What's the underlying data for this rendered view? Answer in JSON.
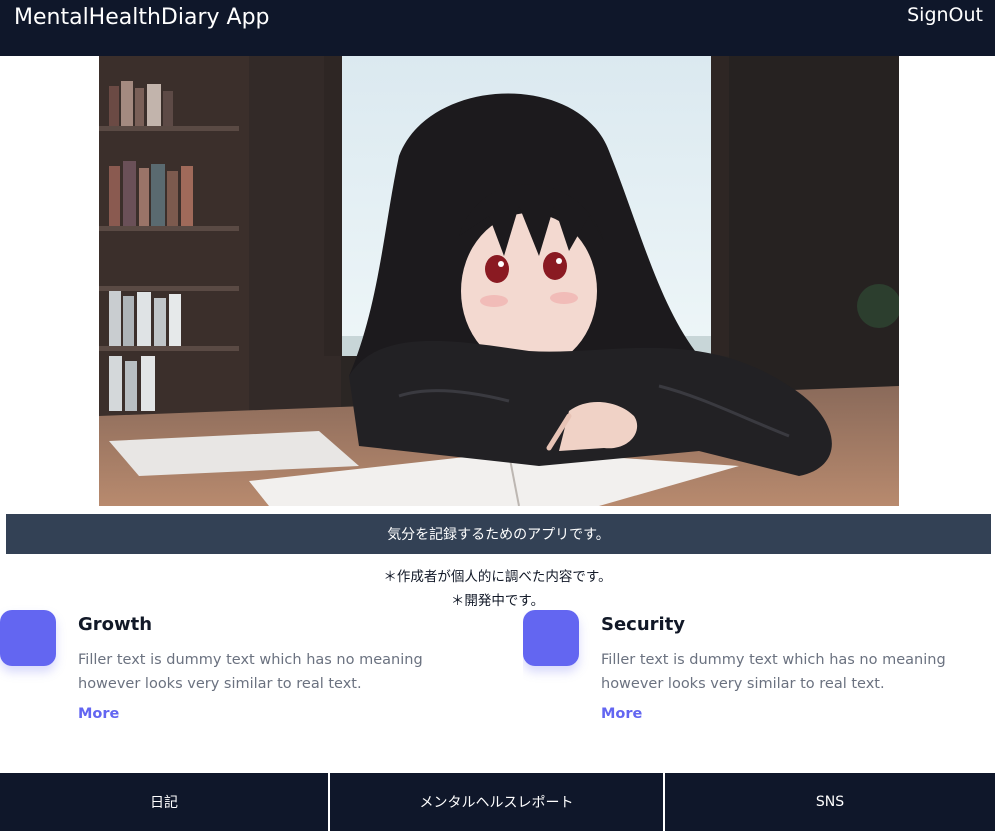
{
  "header": {
    "title": "MentalHealthDiary App",
    "signout_label": "SignOut"
  },
  "hero": {
    "image_icon": "hero-illustration-icon"
  },
  "banner": {
    "text": "気分を記録するためのアプリです。"
  },
  "notes": [
    "＊作成者が個人的に調べた内容です。",
    "＊開発中です。"
  ],
  "features": [
    {
      "title": "Growth",
      "text": "Filler text is dummy text which has no meaning however looks very similar to real text.",
      "more_label": "More"
    },
    {
      "title": "Security",
      "text": "Filler text is dummy text which has no meaning however looks very similar to real text.",
      "more_label": "More"
    }
  ],
  "footer": {
    "items": [
      {
        "label": "日記"
      },
      {
        "label": "メンタルヘルスレポート"
      },
      {
        "label": "SNS"
      }
    ]
  },
  "colors": {
    "header_bg": "#0f172a",
    "banner_bg": "#334155",
    "accent": "#6366f1",
    "muted_text": "#6b7280"
  }
}
